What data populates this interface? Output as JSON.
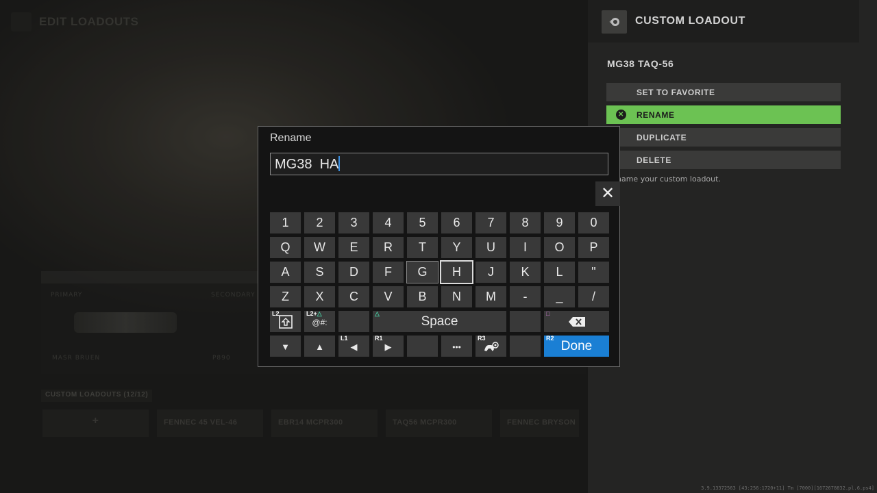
{
  "background": {
    "title": "EDIT LOADOUTS",
    "panel_labels": [
      "PRIMARY",
      "SECONDARY"
    ],
    "weapon_names": [
      "MASR BRUEN",
      "P890"
    ],
    "custom_loadouts_label": "CUSTOM LOADOUTS (12/12)",
    "slots": [
      "+",
      "FENNEC 45  VEL-46",
      "EBR14 MCPR300",
      "TAQ56 MCPR300",
      "FENNEC BRYSON"
    ]
  },
  "side_panel": {
    "title": "CUSTOM LOADOUT",
    "loadout_name": "MG38  TAQ-56",
    "menu": [
      {
        "label": "SET TO FAVORITE",
        "active": false
      },
      {
        "label": "RENAME",
        "active": true
      },
      {
        "label": "DUPLICATE",
        "active": false
      },
      {
        "label": "DELETE",
        "active": false
      }
    ],
    "hint": "name your custom loadout."
  },
  "dialog": {
    "title": "Rename",
    "input_value": "MG38  HA",
    "close_label": "✕",
    "rows": [
      [
        "1",
        "2",
        "3",
        "4",
        "5",
        "6",
        "7",
        "8",
        "9",
        "0"
      ],
      [
        "Q",
        "W",
        "E",
        "R",
        "T",
        "Y",
        "U",
        "I",
        "O",
        "P"
      ],
      [
        "A",
        "S",
        "D",
        "F",
        "G",
        "H",
        "J",
        "K",
        "L",
        "\""
      ],
      [
        "Z",
        "X",
        "C",
        "V",
        "B",
        "N",
        "M",
        "-",
        "_",
        "/"
      ]
    ],
    "focused_key": "H",
    "selected_key": "G",
    "row5": {
      "shift_tag": "L2",
      "symbols_tag": "L2+",
      "symbols_label": "@#:",
      "space_label": "Space",
      "backspace_tag": "□"
    },
    "row6": {
      "left_tag": "L1",
      "right_tag": "R1",
      "more_label": "•••",
      "cursor_tag": "R3",
      "done_tag": "R2",
      "done_label": "Done"
    }
  },
  "debug_text": "3.9.13372563 [43:256:1720+11] Tm [7000][1672678832.pl.6.ps4]"
}
